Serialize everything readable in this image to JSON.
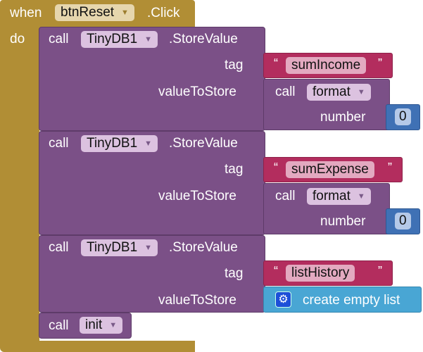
{
  "event": {
    "when": "when",
    "component": "btnReset",
    "event": ".Click",
    "do": "do"
  },
  "blocks": [
    {
      "call": "call",
      "component": "TinyDB1",
      "method": ".StoreValue",
      "tag_label": "tag",
      "value_label": "valueToStore",
      "tag": "sumIncome",
      "value": {
        "call": "call",
        "proc": "format",
        "arg_label": "number",
        "number": "0"
      }
    },
    {
      "call": "call",
      "component": "TinyDB1",
      "method": ".StoreValue",
      "tag_label": "tag",
      "value_label": "valueToStore",
      "tag": "sumExpense",
      "value": {
        "call": "call",
        "proc": "format",
        "arg_label": "number",
        "number": "0"
      }
    },
    {
      "call": "call",
      "component": "TinyDB1",
      "method": ".StoreValue",
      "tag_label": "tag",
      "value_label": "valueToStore",
      "tag": "listHistory",
      "value": {
        "label": "create empty list",
        "icon": "gear-icon"
      }
    },
    {
      "call": "call",
      "proc": "init"
    }
  ],
  "quote_open": "“",
  "quote_close": "”",
  "dropdown_arrow": "▼",
  "colors": {
    "event": "#B18E35",
    "procedure": "#7B5087",
    "text": "#B32D5E",
    "math": "#3F71B5",
    "list": "#49A6D4"
  }
}
